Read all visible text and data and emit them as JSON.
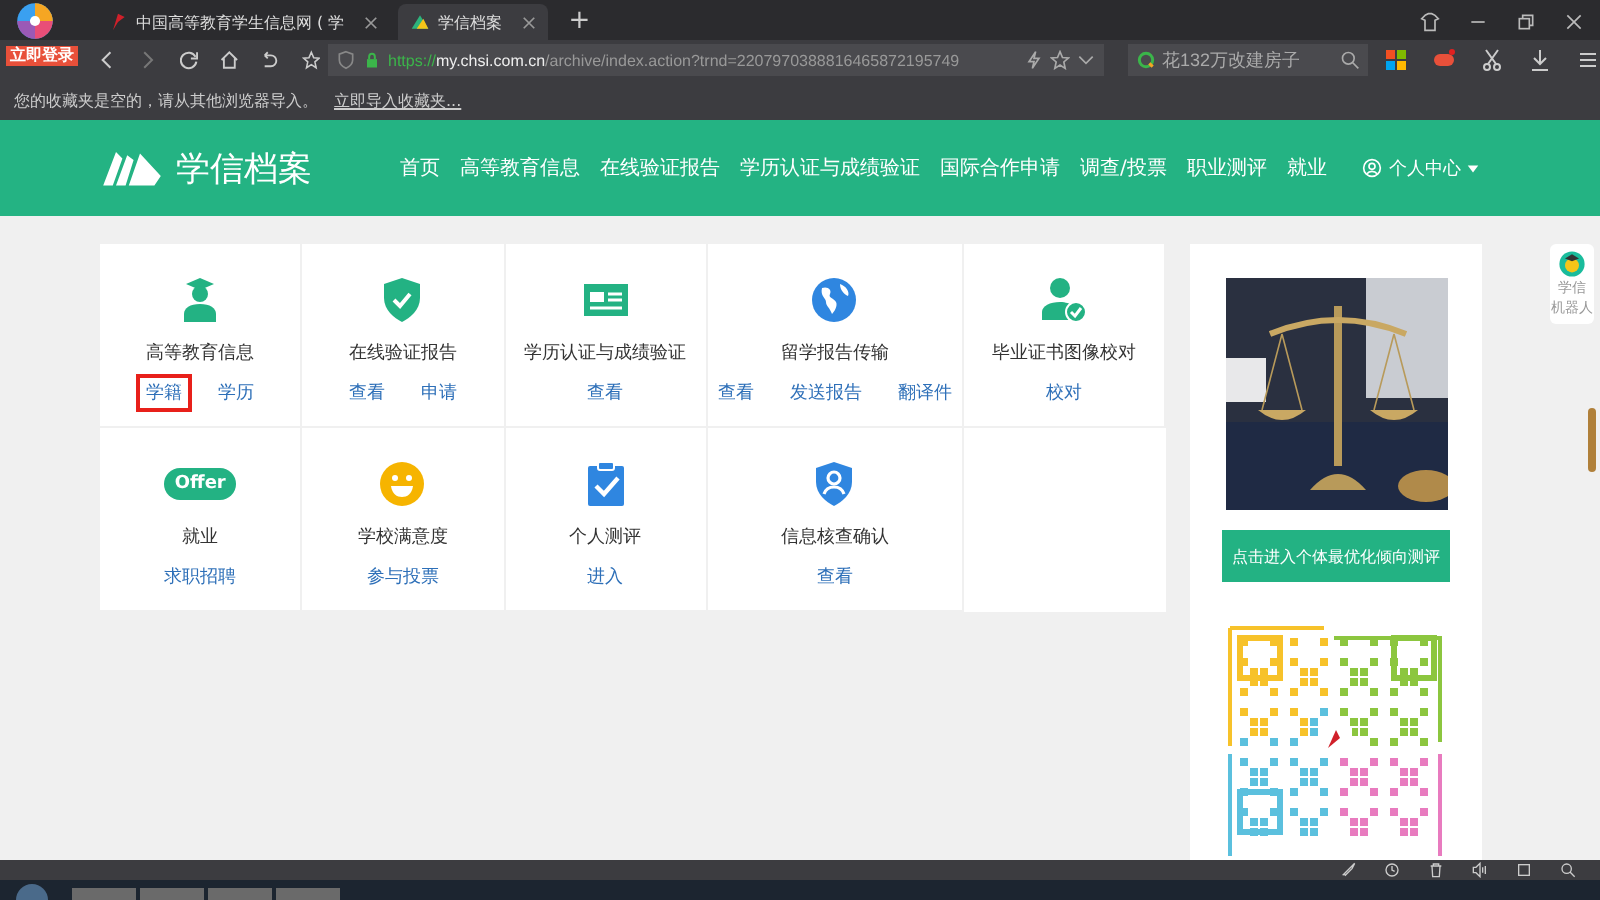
{
  "browser": {
    "login_badge": "立即登录",
    "tabs": [
      {
        "title": "中国高等教育学生信息网 ( 学",
        "selected": false
      },
      {
        "title": "学信档案",
        "selected": true
      }
    ],
    "new_tab": "+",
    "url": {
      "scheme": "https://",
      "host": "my.chsi.com.cn",
      "path": "/archive/index.action?trnd=2207970388816465872195749"
    },
    "search": {
      "placeholder": "花132万改建房子"
    },
    "bookmarks_bar": {
      "message": "您的收藏夹是空的，请从其他浏览器导入。",
      "link": "立即导入收藏夹..."
    }
  },
  "site": {
    "logo_text": "学信档案",
    "nav": [
      {
        "label": "首页"
      },
      {
        "label": "高等教育信息"
      },
      {
        "label": "在线验证报告"
      },
      {
        "label": "学历认证与成绩验证"
      },
      {
        "label": "国际合作申请"
      },
      {
        "label": "调查/投票"
      },
      {
        "label": "职业测评"
      },
      {
        "label": "就业"
      }
    ],
    "user_menu": "个人中心"
  },
  "services": [
    {
      "kind": "graduate",
      "title": "高等教育信息",
      "links": [
        {
          "label": "学籍",
          "highlighted": true
        },
        {
          "label": "学历",
          "highlighted": false
        }
      ]
    },
    {
      "kind": "shield-check",
      "title": "在线验证报告",
      "links": [
        {
          "label": "查看",
          "highlighted": false
        },
        {
          "label": "申请",
          "highlighted": false
        }
      ]
    },
    {
      "kind": "id-card",
      "title": "学历认证与成绩验证",
      "links": [
        {
          "label": "查看",
          "highlighted": false
        }
      ]
    },
    {
      "kind": "globe",
      "title": "留学报告传输",
      "links": [
        {
          "label": "查看",
          "highlighted": false
        },
        {
          "label": "发送报告",
          "highlighted": false
        },
        {
          "label": "翻译件",
          "highlighted": false
        }
      ]
    },
    {
      "kind": "person-check",
      "title": "毕业证书图像校对",
      "links": [
        {
          "label": "校对",
          "highlighted": false
        }
      ]
    },
    {
      "kind": "offer",
      "badge": "Offer",
      "title": "就业",
      "links": [
        {
          "label": "求职招聘",
          "highlighted": false
        }
      ]
    },
    {
      "kind": "smiley",
      "title": "学校满意度",
      "links": [
        {
          "label": "参与投票",
          "highlighted": false
        }
      ]
    },
    {
      "kind": "clipboard",
      "title": "个人测评",
      "links": [
        {
          "label": "进入",
          "highlighted": false
        }
      ]
    },
    {
      "kind": "shield-user",
      "title": "信息核查确认",
      "links": [
        {
          "label": "查看",
          "highlighted": false
        }
      ]
    }
  ],
  "sidebar": {
    "promo_button": "点击进入个体最优化倾向测评"
  },
  "robot": {
    "lines": [
      "学信",
      "机器人"
    ]
  }
}
